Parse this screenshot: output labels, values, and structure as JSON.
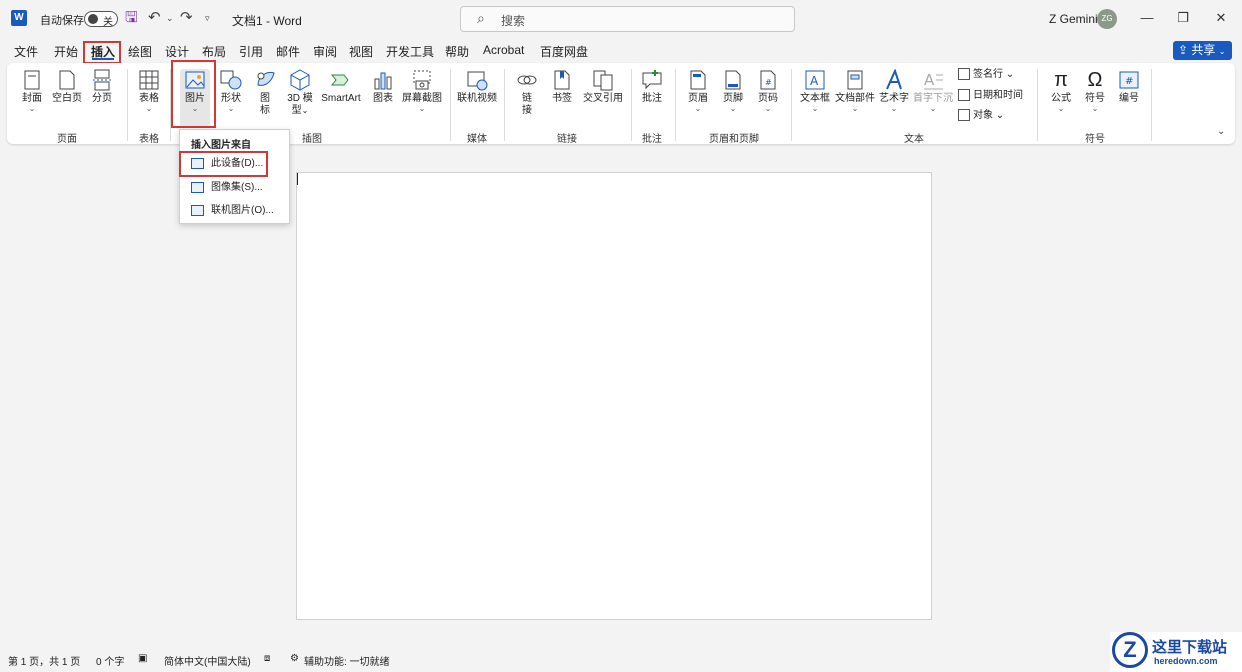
{
  "titlebar": {
    "app_icon": "W",
    "autosave_label": "自动保存",
    "autosave_state": "关",
    "doc_title": "文档1  -  Word",
    "search_placeholder": "搜索",
    "user_name": "Z Gemini",
    "user_initials": "ZG"
  },
  "tabs": [
    "文件",
    "开始",
    "插入",
    "绘图",
    "设计",
    "布局",
    "引用",
    "邮件",
    "审阅",
    "视图",
    "开发工具",
    "帮助",
    "Acrobat",
    "百度网盘"
  ],
  "active_tab": "插入",
  "share_label": "共享",
  "ribbon": {
    "buttons": {
      "cover": "封面",
      "blank": "空白页",
      "pagebreak": "分页",
      "table": "表格",
      "picture": "图片",
      "shapes": "形状",
      "icons_1": "图",
      "icons_2": "标",
      "model3d_1": "3D 模",
      "model3d_2": "型",
      "smartart": "SmartArt",
      "chart": "图表",
      "screenshot": "屏幕截图",
      "video": "联机视频",
      "link_1": "链",
      "link_2": "接",
      "bookmark": "书签",
      "crossref": "交叉引用",
      "comment": "批注",
      "header": "页眉",
      "footer": "页脚",
      "pagenum": "页码",
      "textbox": "文本框",
      "quickparts": "文档部件",
      "wordart": "艺术字",
      "dropcap": "首字下沉",
      "signature": "签名行",
      "datetime": "日期和时间",
      "object": "对象",
      "equation": "公式",
      "symbol": "符号",
      "numbering": "编号"
    },
    "groups": {
      "pages": "页面",
      "tables": "表格",
      "illustrations": "插图",
      "media": "媒体",
      "links": "链接",
      "comments": "批注",
      "headerfooter": "页眉和页脚",
      "text": "文本",
      "symbols": "符号"
    }
  },
  "dropdown": {
    "header": "插入图片来自",
    "items": [
      "此设备(D)...",
      "图像集(S)...",
      "联机图片(O)..."
    ]
  },
  "status": {
    "page": "第 1 页，共 1 页",
    "words": "0 个字",
    "language": "简体中文(中国大陆)",
    "accessibility": "辅助功能: 一切就绪"
  },
  "watermark": {
    "logo": "Z",
    "text": "这里下载站",
    "url": "heredown.com"
  },
  "colors": {
    "accent": "#185abd",
    "highlight": "#d23838"
  }
}
